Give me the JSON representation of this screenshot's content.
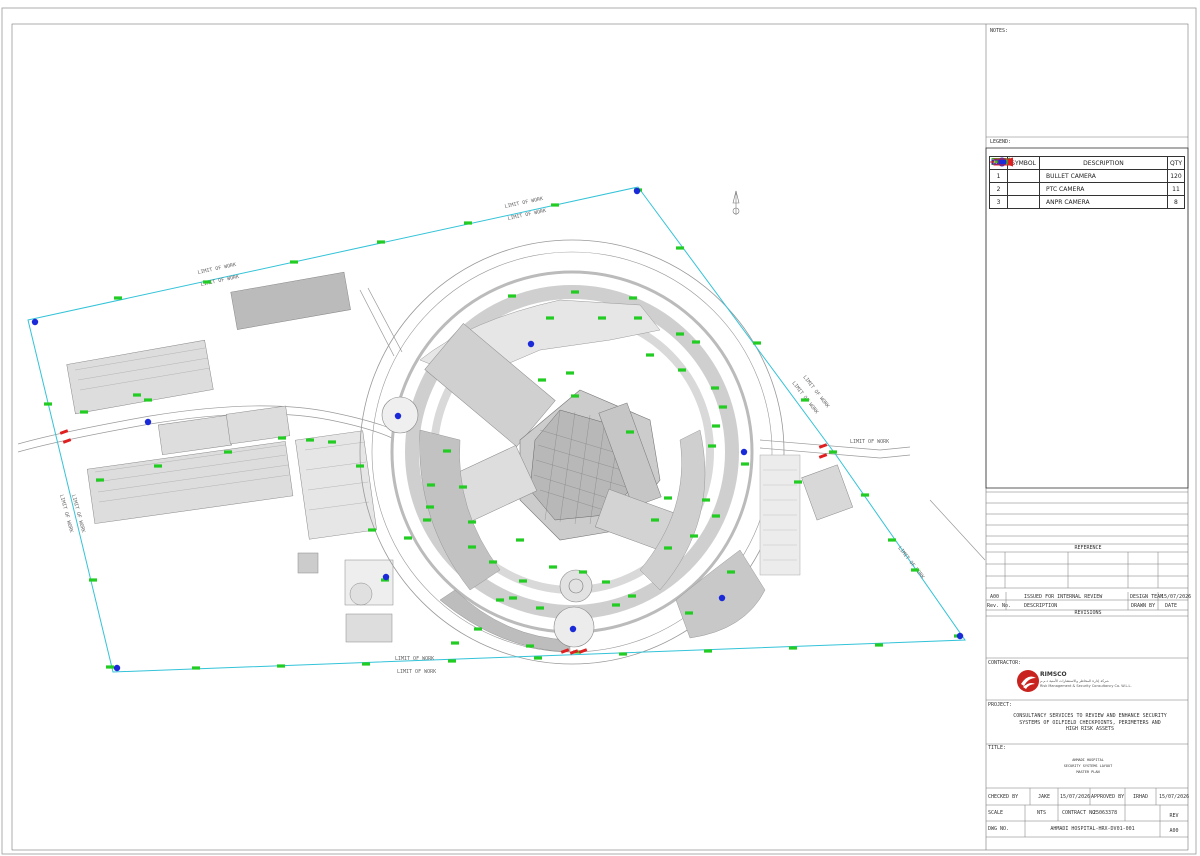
{
  "notes_label": "NOTES:",
  "legend": {
    "label": "LEGEND:",
    "headers": {
      "nos": "NOS",
      "symbol": "SYMBOL",
      "description": "DESCRIPTION",
      "qty": "QTY"
    },
    "rows": [
      {
        "nos": "1",
        "symbol_icon": "bullet-camera-icon",
        "description": "BULLET CAMERA",
        "qty": "120",
        "color": "#22cc22"
      },
      {
        "nos": "2",
        "symbol_icon": "ptz-camera-icon",
        "description": "PTC CAMERA",
        "qty": "11",
        "color": "#1a2ad8"
      },
      {
        "nos": "3",
        "symbol_icon": "anpr-camera-icon",
        "description": "ANPR CAMERA",
        "qty": "8",
        "color": "#e02020"
      }
    ]
  },
  "map": {
    "limit_of_work_label": "LIMIT OF WORK",
    "boundary_color": "#33c3d8",
    "north_arrow_icon": "north-arrow-icon"
  },
  "reference_label": "REFERENCE",
  "revision": {
    "rev": "A00",
    "description": "ISSUED FOR INTERNAL REVIEW",
    "drawn_by": "DESIGN TEAM",
    "date": "15/07/2026",
    "headers": {
      "rev_no": "Rev. No.",
      "description": "DESCRIPTION",
      "drawn_by": "DRAWN BY",
      "date": "DATE"
    },
    "section_label": "REVISIONS"
  },
  "contractor": {
    "label": "CONTRACTOR:",
    "logo_icon": "rimsco-logo-icon",
    "name": "RIMSCO",
    "arabic": "شركة إدارة المخاطر والاستشارات الأمنية ذ.م.م",
    "english": "Risk Management & Security Consultancy Co. W.L.L."
  },
  "project": {
    "label": "PROJECT:",
    "text": "CONSULTANCY SERVICES TO REVIEW AND ENHANCE SECURITY SYSTEMS OF OILFIELD CHECKPOINTS, PERIMETERS AND HIGH RISK ASSETS"
  },
  "title": {
    "label": "TITLE:",
    "line1": "AHMADI HOSPITAL",
    "line2": "SECURITY SYSTEMS LAYOUT",
    "line3": "MASTER PLAN"
  },
  "signoff": {
    "checked_by_label": "CHECKED BY",
    "checked_by": "JAKE",
    "checked_date": "15/07/2026",
    "approved_by_label": "APPROVED BY",
    "approved_by": "IRHAD",
    "approved_date": "15/07/2026",
    "scale_label": "SCALE",
    "scale": "NTS",
    "contract_label": "CONTRACT NO.",
    "contract": "25063378",
    "rev_label": "REV",
    "dwg_label": "DWG NO.",
    "dwg_no": "AHMADI HOSPITAL-HRX-DV01-001",
    "rev": "A00"
  }
}
